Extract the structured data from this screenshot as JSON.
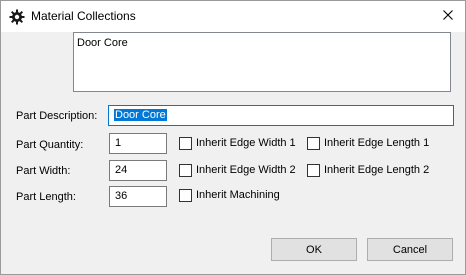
{
  "window": {
    "title": "Material Collections",
    "icon": "gear-icon",
    "close_icon": "close-icon"
  },
  "collection_list": {
    "items": [
      "Door Core"
    ]
  },
  "fields": {
    "description": {
      "label": "Part Description:",
      "value": "Door Core"
    },
    "quantity": {
      "label": "Part Quantity:",
      "value": "1"
    },
    "width": {
      "label": "Part Width:",
      "value": "24"
    },
    "length": {
      "label": "Part Length:",
      "value": "36"
    }
  },
  "checkboxes": {
    "inherit_edge_width_1": {
      "label": "Inherit Edge Width 1",
      "checked": false
    },
    "inherit_edge_length_1": {
      "label": "Inherit Edge Length 1",
      "checked": false
    },
    "inherit_edge_width_2": {
      "label": "Inherit Edge Width 2",
      "checked": false
    },
    "inherit_edge_length_2": {
      "label": "Inherit Edge Length 2",
      "checked": false
    },
    "inherit_machining": {
      "label": "Inherit Machining",
      "checked": false
    }
  },
  "buttons": {
    "ok": "OK",
    "cancel": "Cancel"
  }
}
